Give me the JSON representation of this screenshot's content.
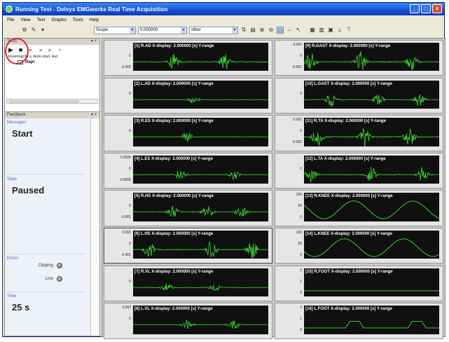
{
  "window": {
    "title": "Running Test - Delsys EMGworks Real Time Acquisition",
    "buttons": [
      "_",
      "□",
      "×"
    ]
  },
  "menu": [
    "File",
    "View",
    "Test",
    "Graphs",
    "Tools",
    "Help"
  ],
  "toolbar": {
    "combo_scope": "Scope",
    "combo_value": "0.000000",
    "combo_mode": "other",
    "icons": [
      "tb-a",
      "tb-b",
      "tb-c",
      "tb-d",
      "tb-e",
      "tb-f",
      "tb-g",
      "tb-h",
      "tb-i",
      "tb-j",
      "tb-k",
      "tb-l",
      "tb-m",
      "tb-n"
    ]
  },
  "tests_panel": {
    "header": "Tests",
    "controls": "▾ ×",
    "buttons": [
      "▶",
      "■",
      "●",
      "◂",
      "▸",
      "▪"
    ],
    "status_line": "Running(30 s, Auto start, Aut",
    "node_label": "Rept"
  },
  "feedback": {
    "header": "Feedback",
    "controls": "▾ ×",
    "message_label": "Messages",
    "message": "Start",
    "state_label": "State",
    "state": "Paused",
    "errors_label": "Errors",
    "clipping_label": "Clipping",
    "line_label": "Line",
    "time_label": "Time",
    "time": "25 s"
  },
  "plots": [
    {
      "label": "[1] R.AD X-display: 2.000000 [s] Y-range",
      "yticks": [
        "",
        "0",
        "-0.002"
      ],
      "signal": "emg",
      "amp": 0.3,
      "bursts": [
        0.3,
        0.68
      ]
    },
    {
      "label": "[2] L.AD X-display: 2.000000 [s] Y-range",
      "yticks": [
        "",
        "0",
        ""
      ],
      "signal": "emg",
      "amp": 0.18,
      "bursts": [
        0.45
      ]
    },
    {
      "label": "[3] R.ES X-display: 2.000000 [s] Y-range",
      "yticks": [
        "",
        "0",
        ""
      ],
      "signal": "emg",
      "amp": 0.2,
      "bursts": [
        0.4
      ]
    },
    {
      "label": "[4] L.ES X-display: 2.000000 [s] Y-range",
      "yticks": [
        "0.0005",
        "0",
        "-0.0005"
      ],
      "signal": "emg",
      "amp": 0.22,
      "bursts": [
        0.35,
        0.75
      ]
    },
    {
      "label": "[5] R.HS X-display: 2.000000 [s] Y-range",
      "yticks": [
        "",
        "0",
        "-0.001"
      ],
      "signal": "emg",
      "amp": 0.25,
      "bursts": [
        0.3,
        0.55,
        0.8
      ]
    },
    {
      "label": "[6] L.HS X-display: 2.000000 [s] Y-range",
      "yticks": [
        "0.001",
        "0",
        "-0.001"
      ],
      "signal": "emg",
      "amp": 0.35,
      "bursts": [
        0.12,
        0.58,
        0.88
      ],
      "active": true
    },
    {
      "label": "[7] R.VL X-display: 2.000000 [s] Y-range",
      "yticks": [
        "",
        "0",
        ""
      ],
      "signal": "emg",
      "amp": 0.18,
      "bursts": [
        0.25,
        0.6
      ]
    },
    {
      "label": "[8] L.VL X-display: 2.000000 [s] Y-range",
      "yticks": [
        "0.002",
        "0",
        ""
      ],
      "signal": "emg",
      "amp": 0.2,
      "bursts": [
        0.4,
        0.75
      ]
    },
    {
      "label": "[9] R.GAST X-display: 2.000000 [s] Y-range",
      "yticks": [
        "0.002",
        "0",
        "-0.002"
      ],
      "signal": "emg",
      "amp": 0.4,
      "bursts": [
        0.05,
        0.42,
        0.8
      ]
    },
    {
      "label": "[10] L.GAST X-display: 2.000000 [s] Y-range",
      "yticks": [
        "",
        "0",
        ""
      ],
      "signal": "emg",
      "amp": 0.25,
      "bursts": [
        0.2,
        0.55,
        0.85
      ]
    },
    {
      "label": "[11] R.TA X-display: 2.000000 [s] Y-range",
      "yticks": [
        "0.002",
        "0",
        "-0.002"
      ],
      "signal": "emg",
      "amp": 0.35,
      "bursts": [
        0.1,
        0.45,
        0.78
      ]
    },
    {
      "label": "[12] L.TA X-display: 2.000000 [s] Y-range",
      "yticks": [
        "",
        "0",
        ""
      ],
      "signal": "emg",
      "amp": 0.3,
      "bursts": [
        0.05,
        0.5,
        0.88
      ]
    },
    {
      "label": "[13] R.KNEE X-display: 2.000000 [s] Y-range",
      "yticks": [
        "100",
        "50",
        "0"
      ],
      "signal": "wave",
      "amp": 0.35
    },
    {
      "label": "[14] L.KNEE X-display: 2.000000 [s] Y-range",
      "yticks": [
        "100",
        "50",
        "0"
      ],
      "signal": "wave",
      "amp": 0.35
    },
    {
      "label": "[15] R.FOOT X-display: 2.000000 [s] Y-range",
      "yticks": [
        "2",
        "1",
        "0"
      ],
      "signal": "flat",
      "amp": 0.0
    },
    {
      "label": "[16] L.FOOT X-display: 2.000000 [s] Y-range",
      "yticks": [
        "2",
        "1",
        "0"
      ],
      "signal": "foot",
      "amp": 0.25
    }
  ],
  "colors": {
    "trace": "#3ddc2e",
    "screen": "#101010",
    "highlight": "#e8202a"
  }
}
